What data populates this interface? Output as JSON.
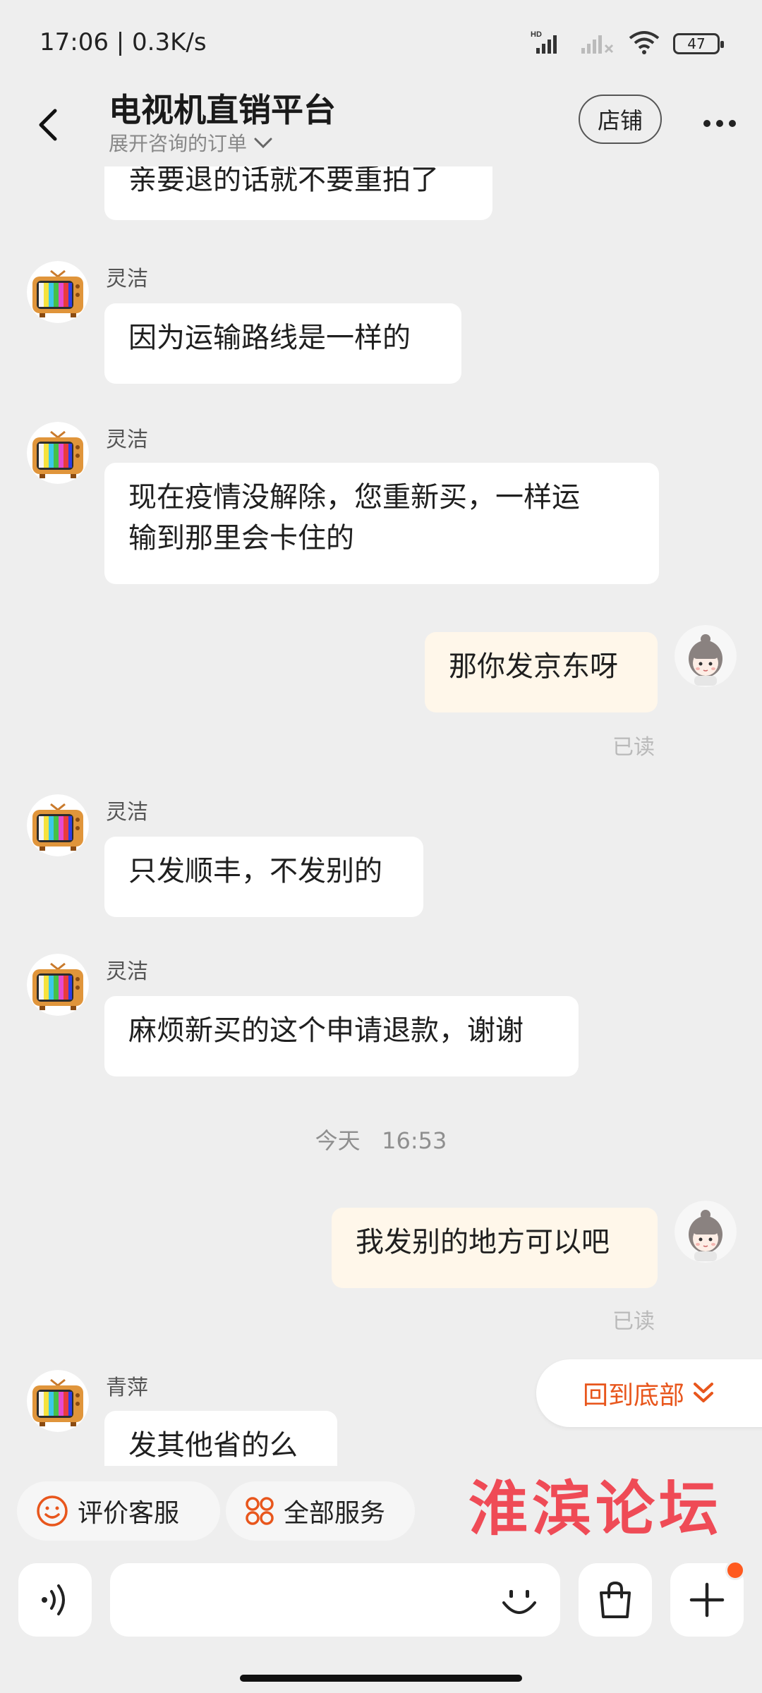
{
  "status_bar": {
    "time": "17:06 | 0.3K/s",
    "battery": "47",
    "icons": [
      "hd-signal-icon",
      "signal-icon",
      "wifi-icon",
      "battery-icon"
    ]
  },
  "header": {
    "title": "电视机直销平台",
    "subtitle": "展开咨询的订单",
    "store_label": "店铺",
    "back_icon": "chevron-left-icon",
    "more_icon": "more-dots-icon"
  },
  "messages": [
    {
      "side": "left",
      "text": "亲要退的话就不要重拍了"
    },
    {
      "side": "left",
      "sender": "灵洁",
      "text": "因为运输路线是一样的"
    },
    {
      "side": "left",
      "sender": "灵洁",
      "text_lines": [
        "现在疫情没解除，您重新买，一样运",
        "输到那里会卡住的"
      ]
    },
    {
      "side": "right",
      "text": "那你发京东呀",
      "status": "已读"
    },
    {
      "side": "left",
      "sender": "灵洁",
      "text": "只发顺丰，不发别的"
    },
    {
      "side": "left",
      "sender": "灵洁",
      "text": "麻烦新买的这个申请退款，谢谢"
    },
    {
      "type": "time",
      "text": "今天   16:53"
    },
    {
      "side": "right",
      "text": "我发别的地方可以吧",
      "status": "已读"
    },
    {
      "side": "left",
      "sender": "青萍",
      "text": "发其他省的么"
    }
  ],
  "back_to_bottom": "回到底部",
  "quick_actions": [
    {
      "label": "评价客服",
      "icon": "smile-icon"
    },
    {
      "label": "全部服务",
      "icon": "grid-icon"
    }
  ],
  "watermark": "淮滨论坛",
  "input_bar": {
    "voice_icon": "voice-icon",
    "emoji_icon": "emoji-icon",
    "bag_icon": "shopping-bag-icon",
    "plus_icon": "plus-icon"
  },
  "colors": {
    "accent": "#e8561c",
    "my_bubble": "#fff7ea",
    "background": "#eeeeee"
  }
}
